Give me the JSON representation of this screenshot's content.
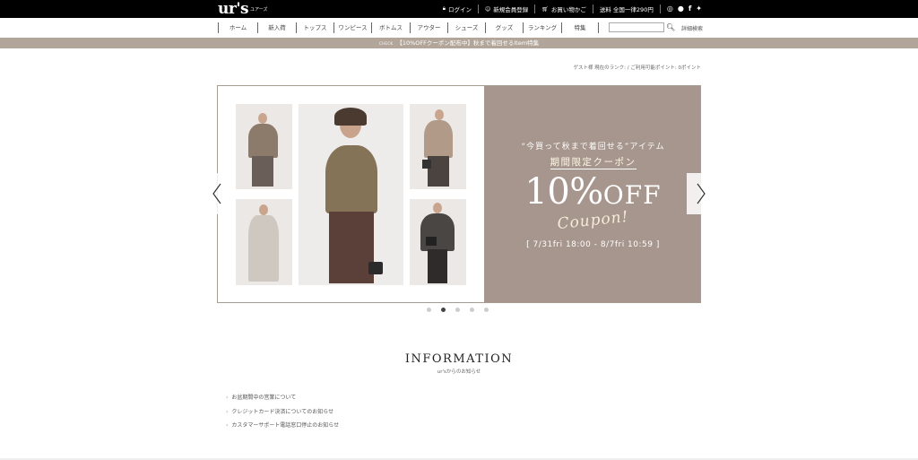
{
  "header": {
    "logo": "ur's",
    "logo_sub": "ユアーズ",
    "links": [
      {
        "icon": "lock-icon",
        "label": "ログイン"
      },
      {
        "icon": "person-add-icon",
        "label": "新規会員登録"
      },
      {
        "icon": "cart-icon",
        "label": "お買い物かご"
      },
      {
        "icon": "",
        "label": "送料 全国一律290円"
      }
    ],
    "social": [
      {
        "icon": "instagram-icon",
        "glyph": "◎"
      },
      {
        "icon": "line-icon",
        "glyph": "●"
      },
      {
        "icon": "facebook-icon",
        "glyph": "f"
      },
      {
        "icon": "twitter-icon",
        "glyph": "✦"
      }
    ]
  },
  "nav": {
    "items": [
      "ホーム",
      "新入荷",
      "トップス",
      "ワンピース",
      "ボトムス",
      "アウター",
      "シューズ",
      "グッズ",
      "ランキング",
      "特集"
    ],
    "search_placeholder": "",
    "advanced_search": "詳細検索"
  },
  "campaign": {
    "tag": "CHECK",
    "text": "【10%OFFクーポン配布中】秋まで着回せるItem特集"
  },
  "member_info": "ゲスト様 現在のランク: / ご利用可能ポイント: 0ポイント",
  "hero": {
    "line1": "“今買って秋まで着回せる”アイテム",
    "line2": "期間限定クーポン",
    "big": "10%",
    "big_off": "OFF",
    "coupon": "Coupon!",
    "date": "[ 7/31fri 18:00 - 8/7fri 10:59 ]",
    "colors": {
      "panel": "#a6968d",
      "accent": "#f6ecd8"
    }
  },
  "carousel": {
    "dots": 5,
    "active": 1
  },
  "information": {
    "title": "INFORMATION",
    "subtitle": "ur'sからのお知らせ",
    "items": [
      "お盆期間中の営業について",
      "クレジットカード決済についてのお知らせ",
      "カスタマーサポート電話窓口停止のお知らせ"
    ]
  }
}
